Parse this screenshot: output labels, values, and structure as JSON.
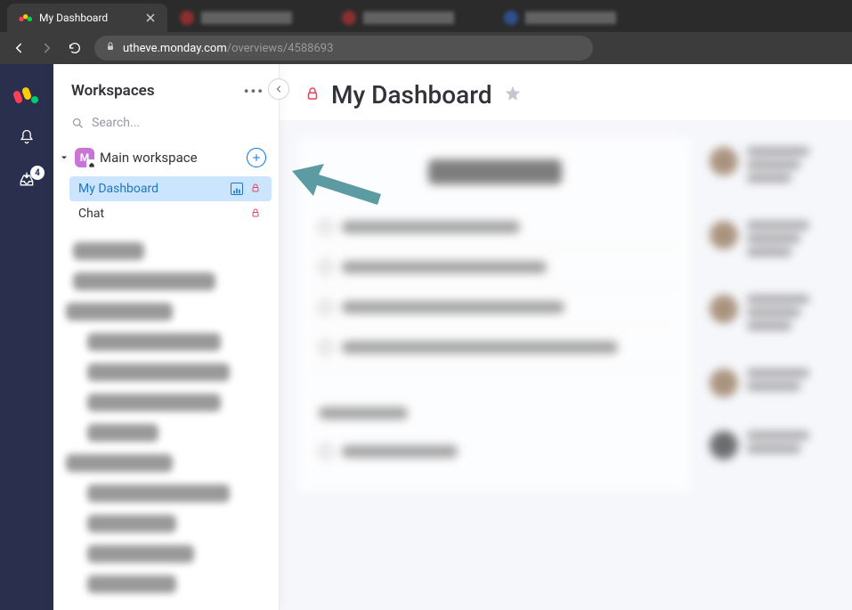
{
  "browser": {
    "active_tab_title": "My Dashboard",
    "url_domain": "utheve.monday.com",
    "url_path": "/overviews/4588693"
  },
  "rail": {
    "inbox_badge": "4"
  },
  "sidebar": {
    "header": "Workspaces",
    "search_placeholder": "Search...",
    "workspace": {
      "badge_letter": "M",
      "name": "Main workspace"
    },
    "boards": [
      {
        "label": "My Dashboard",
        "selected": true,
        "has_chart": true,
        "has_lock": true
      },
      {
        "label": "Chat",
        "selected": false,
        "has_chart": false,
        "has_lock": true
      }
    ]
  },
  "header": {
    "title": "My Dashboard"
  },
  "colors": {
    "accent": "#0073ea",
    "danger": "#e2445c",
    "rail_bg": "#292f4c",
    "annotation": "#5d9ba3"
  }
}
